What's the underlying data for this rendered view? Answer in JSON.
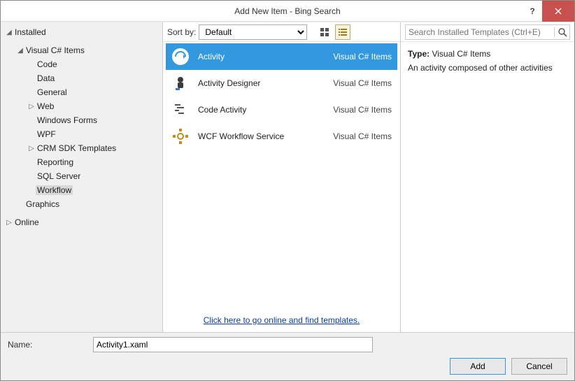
{
  "title": "Add New Item - Bing Search",
  "sidebar": {
    "installed": "Installed",
    "vcs_items": "Visual C# Items",
    "code": "Code",
    "data": "Data",
    "general": "General",
    "web": "Web",
    "winforms": "Windows Forms",
    "wpf": "WPF",
    "crm": "CRM SDK Templates",
    "reporting": "Reporting",
    "sqlserver": "SQL Server",
    "workflow": "Workflow",
    "graphics": "Graphics",
    "online": "Online"
  },
  "toolbar": {
    "sortby_label": "Sort by:",
    "sortby_value": "Default"
  },
  "templates": [
    {
      "name": "Activity",
      "lang": "Visual C# Items",
      "selected": true
    },
    {
      "name": "Activity Designer",
      "lang": "Visual C# Items",
      "selected": false
    },
    {
      "name": "Code Activity",
      "lang": "Visual C# Items",
      "selected": false
    },
    {
      "name": "WCF Workflow Service",
      "lang": "Visual C# Items",
      "selected": false
    }
  ],
  "online_link": "Click here to go online and find templates.",
  "search": {
    "placeholder": "Search Installed Templates (Ctrl+E)"
  },
  "details": {
    "type_label": "Type:",
    "type_value": "Visual C# Items",
    "description": "An activity composed of other activities"
  },
  "footer": {
    "name_label": "Name:",
    "name_value": "Activity1.xaml",
    "add": "Add",
    "cancel": "Cancel"
  }
}
